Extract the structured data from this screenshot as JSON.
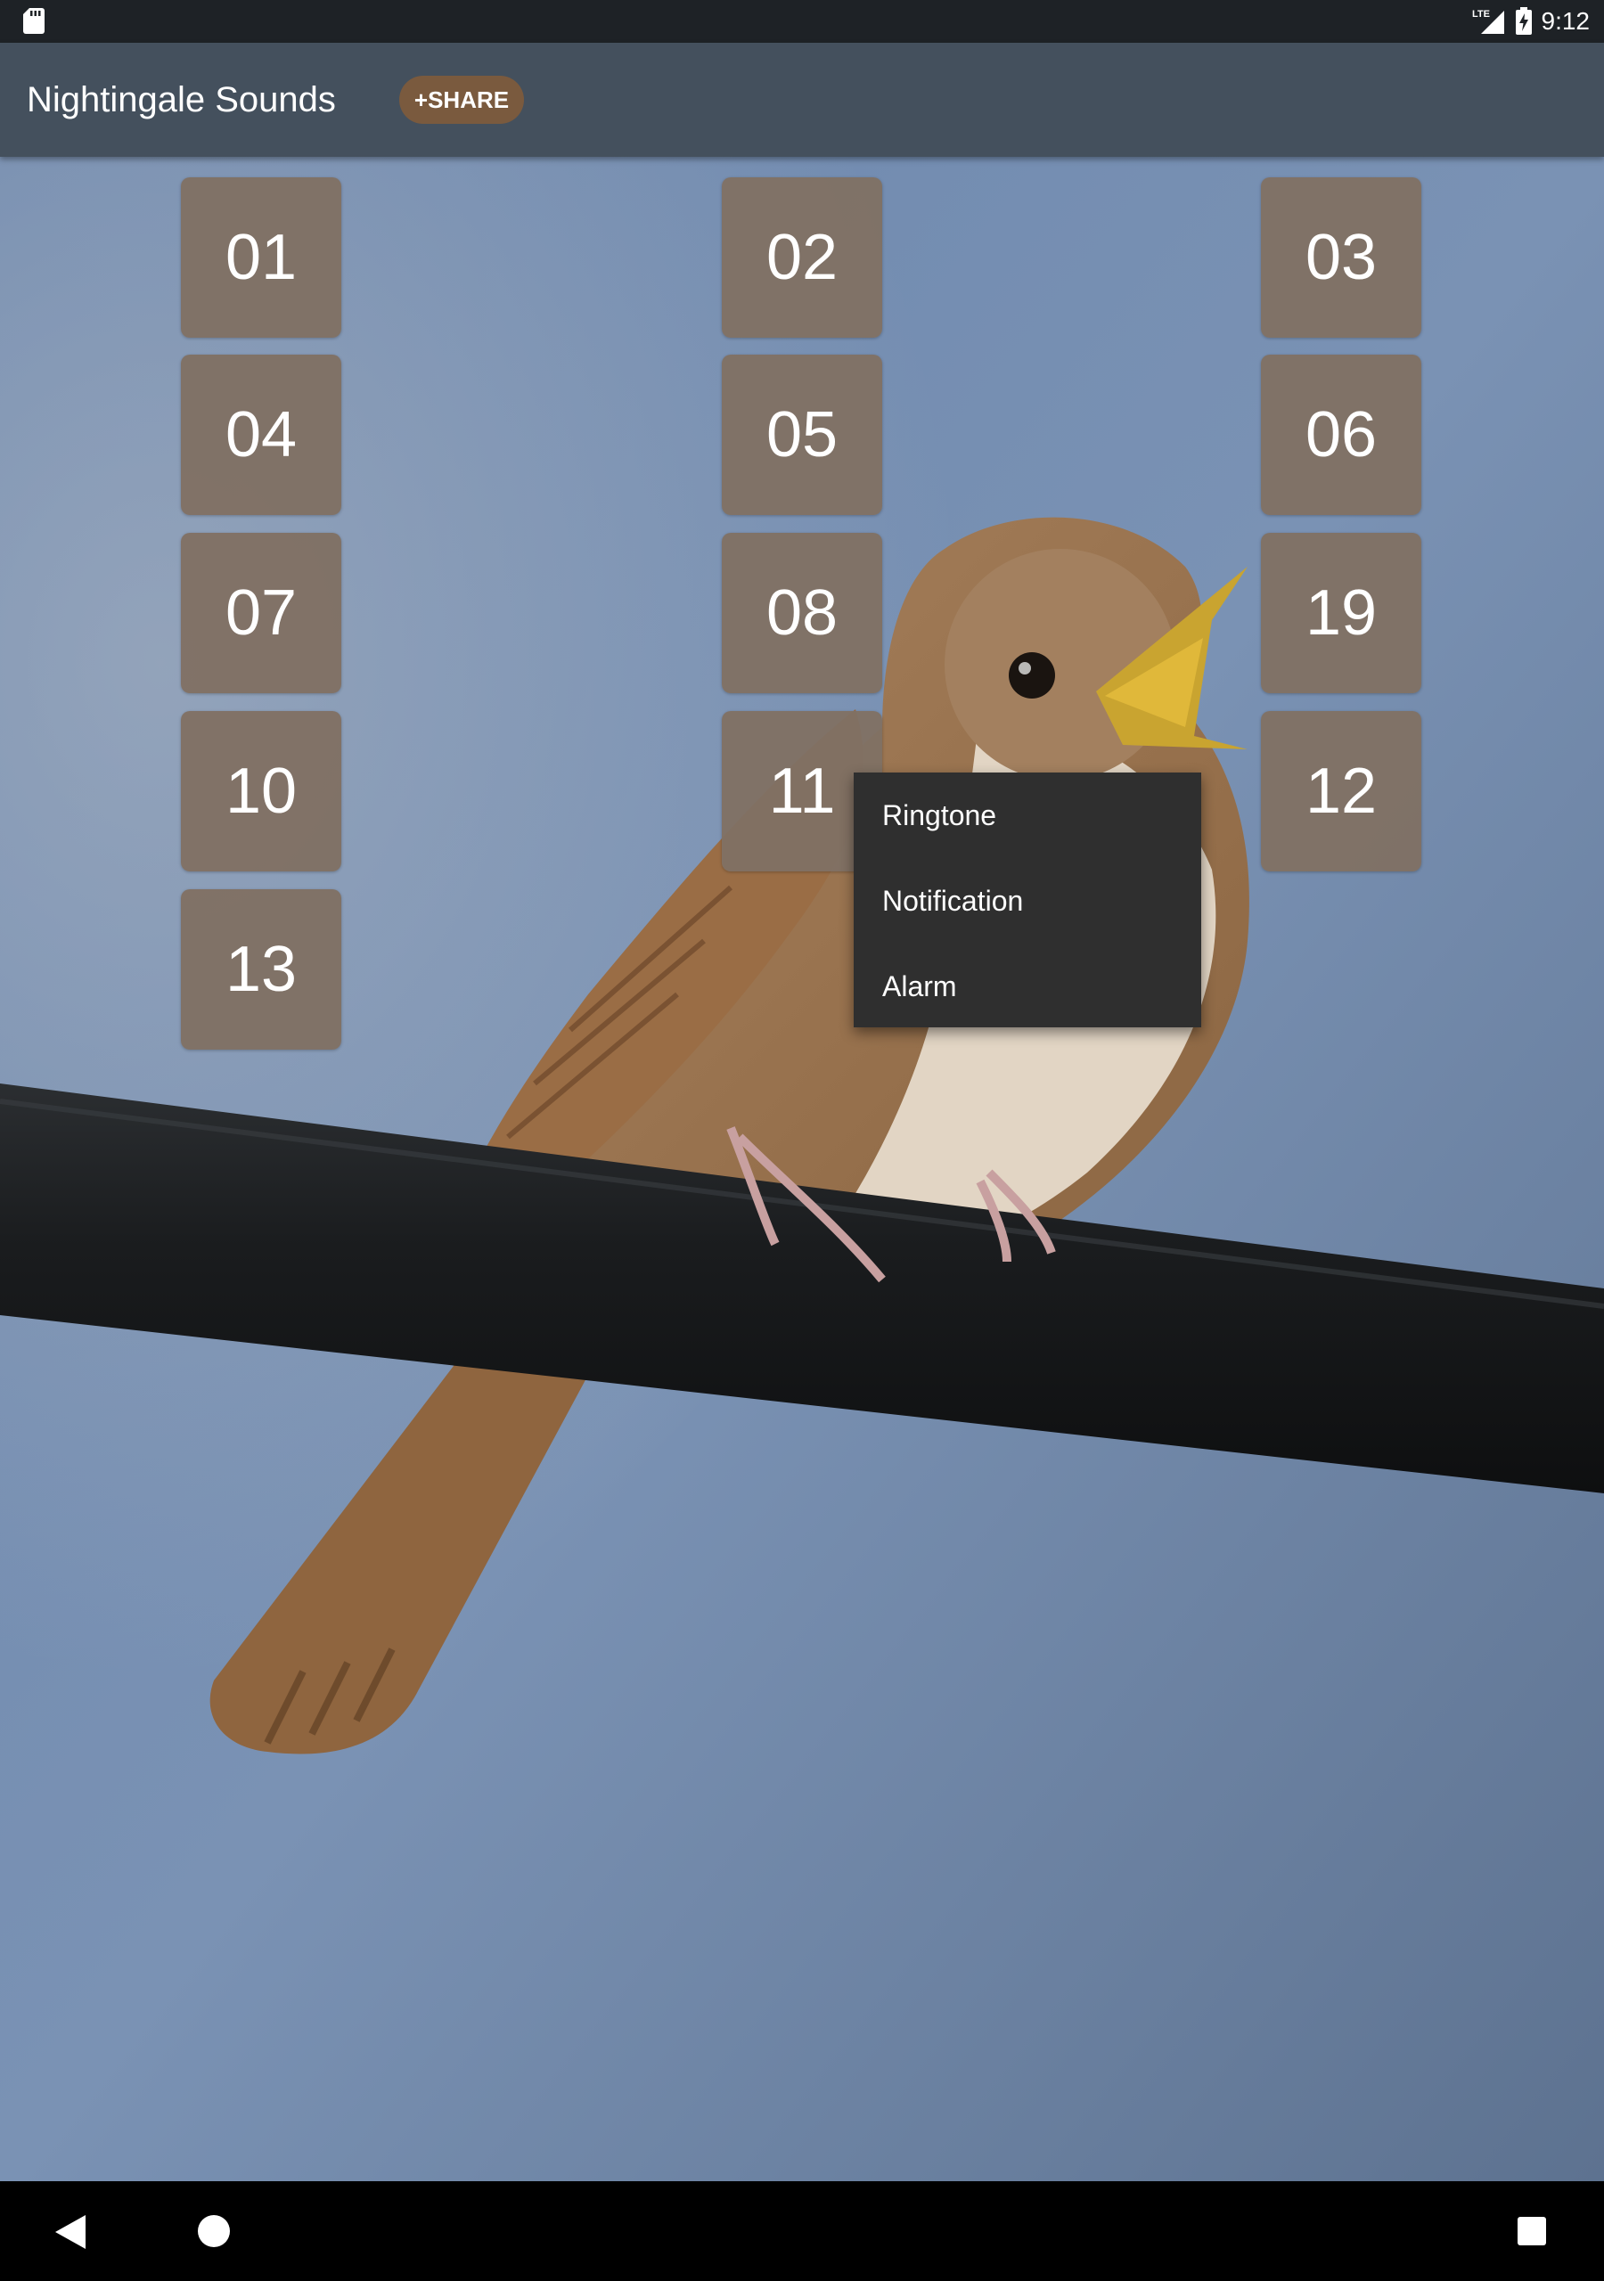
{
  "status_bar": {
    "time": "9:12",
    "network": "LTE",
    "icons": [
      "sd-card-icon",
      "lte-signal-icon",
      "battery-charging-icon"
    ]
  },
  "app_bar": {
    "title": "Nightingale Sounds",
    "share_label": "+SHARE"
  },
  "sounds": [
    "01",
    "02",
    "03",
    "04",
    "05",
    "06",
    "07",
    "08",
    "19",
    "10",
    "11",
    "12",
    "13"
  ],
  "popup_menu": {
    "items": [
      "Ringtone",
      "Notification",
      "Alarm"
    ]
  },
  "nav_bar": {
    "icons": [
      "back-icon",
      "home-icon",
      "recents-icon"
    ]
  },
  "colors": {
    "app_bar": "#44505d",
    "share_button": "#7a5a3e",
    "sound_button": "#807064",
    "menu_background": "#2f2f2f"
  }
}
